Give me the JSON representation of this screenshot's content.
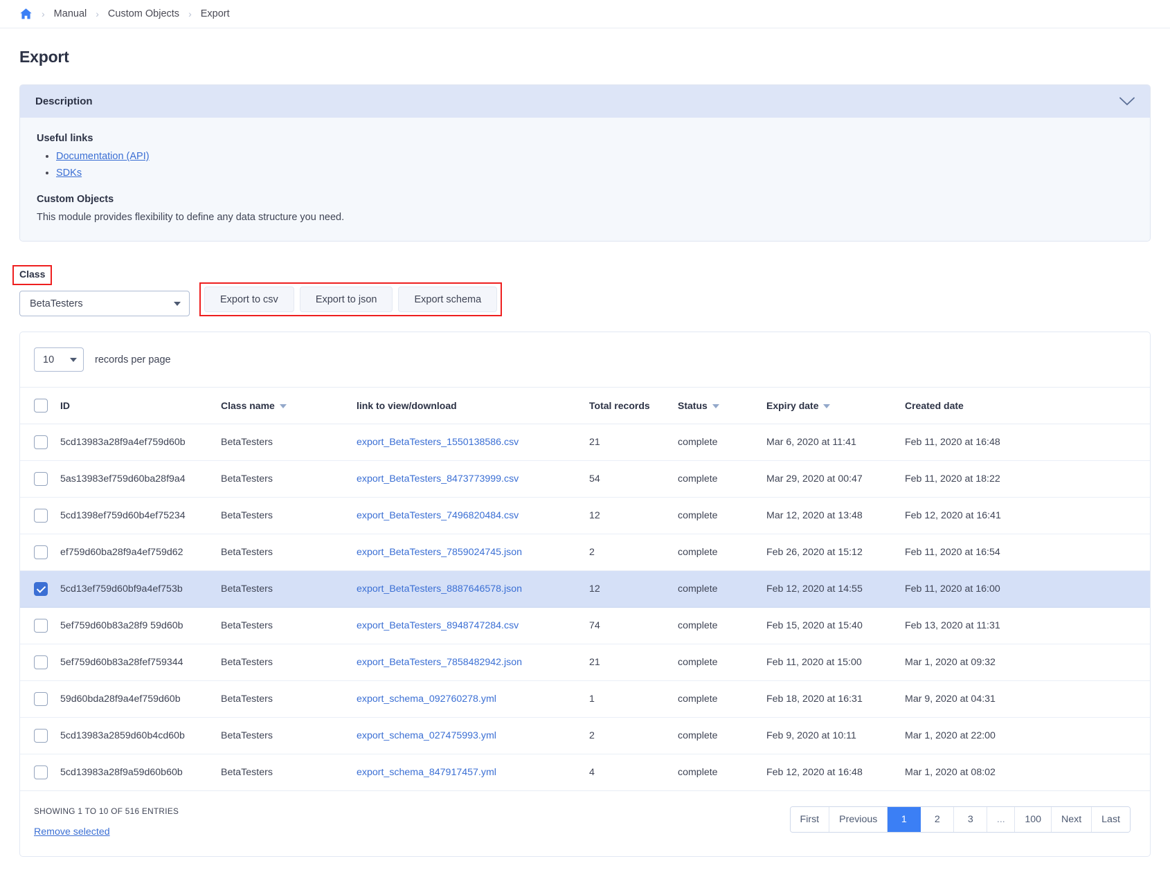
{
  "breadcrumb": {
    "home_icon": "home-icon",
    "items": [
      "Manual",
      "Custom Objects",
      "Export"
    ],
    "separator": "›"
  },
  "page": {
    "title": "Export"
  },
  "description": {
    "header": "Description",
    "collapse_icon": "chevron-down-icon",
    "useful_links_title": "Useful links",
    "links": [
      {
        "label": "Documentation (API)"
      },
      {
        "label": "SDKs"
      }
    ],
    "section_title": "Custom Objects",
    "section_text": "This module provides flexibility to define any data structure you need."
  },
  "class_selector": {
    "label": "Class",
    "value": "BetaTesters",
    "caret_icon": "chevron-down-icon"
  },
  "export_actions": {
    "buttons": [
      "Export to csv",
      "Export to json",
      "Export schema"
    ],
    "highlight_color": "#ee1f1f"
  },
  "table_controls": {
    "records_per_page_value": "10",
    "records_per_page_label": "records per page"
  },
  "table": {
    "select_all_checked": false,
    "columns": [
      {
        "key": "id",
        "label": "ID",
        "sortable": false
      },
      {
        "key": "class_name",
        "label": "Class name",
        "sortable": true
      },
      {
        "key": "link",
        "label": "link to view/download",
        "sortable": false
      },
      {
        "key": "total_records",
        "label": "Total records",
        "sortable": false
      },
      {
        "key": "status",
        "label": "Status",
        "sortable": true
      },
      {
        "key": "expiry_date",
        "label": "Expiry date",
        "sortable": true
      },
      {
        "key": "created_date",
        "label": "Created date",
        "sortable": false
      }
    ],
    "rows": [
      {
        "checked": false,
        "id": "5cd13983a28f9a4ef759d60b",
        "class_name": "BetaTesters",
        "link": "export_BetaTesters_1550138586.csv",
        "total_records": "21",
        "status": "complete",
        "expiry_date": "Mar 6, 2020 at 11:41",
        "created_date": "Feb 11, 2020 at 16:48"
      },
      {
        "checked": false,
        "id": "5as13983ef759d60ba28f9a4",
        "class_name": "BetaTesters",
        "link": "export_BetaTesters_8473773999.csv",
        "total_records": "54",
        "status": "complete",
        "expiry_date": "Mar 29, 2020 at 00:47",
        "created_date": "Feb 11, 2020 at 18:22"
      },
      {
        "checked": false,
        "id": "5cd1398ef759d60b4ef75234",
        "class_name": "BetaTesters",
        "link": "export_BetaTesters_7496820484.csv",
        "total_records": "12",
        "status": "complete",
        "expiry_date": "Mar 12, 2020 at 13:48",
        "created_date": "Feb 12, 2020 at 16:41"
      },
      {
        "checked": false,
        "id": "ef759d60ba28f9a4ef759d62",
        "class_name": "BetaTesters",
        "link": "export_BetaTesters_7859024745.json",
        "total_records": "2",
        "status": "complete",
        "expiry_date": "Feb 26, 2020 at 15:12",
        "created_date": "Feb 11, 2020 at 16:54"
      },
      {
        "checked": true,
        "id": "5cd13ef759d60bf9a4ef753b",
        "class_name": "BetaTesters",
        "link": "export_BetaTesters_8887646578.json",
        "total_records": "12",
        "status": "complete",
        "expiry_date": "Feb 12, 2020 at 14:55",
        "created_date": "Feb 11, 2020 at 16:00"
      },
      {
        "checked": false,
        "id": "5ef759d60b83a28f9 59d60b",
        "class_name": "BetaTesters",
        "link": "export_BetaTesters_8948747284.csv",
        "total_records": "74",
        "status": "complete",
        "expiry_date": "Feb 15, 2020 at 15:40",
        "created_date": "Feb 13, 2020 at 11:31"
      },
      {
        "checked": false,
        "id": "5ef759d60b83a28fef759344",
        "class_name": "BetaTesters",
        "link": "export_BetaTesters_7858482942.json",
        "total_records": "21",
        "status": "complete",
        "expiry_date": "Feb 11, 2020 at 15:00",
        "created_date": "Mar 1, 2020 at 09:32"
      },
      {
        "checked": false,
        "id": "59d60bda28f9a4ef759d60b",
        "class_name": "BetaTesters",
        "link": "export_schema_092760278.yml",
        "total_records": "1",
        "status": "complete",
        "expiry_date": "Feb 18, 2020 at 16:31",
        "created_date": "Mar 9, 2020 at 04:31"
      },
      {
        "checked": false,
        "id": "5cd13983a2859d60b4cd60b",
        "class_name": "BetaTesters",
        "link": "export_schema_027475993.yml",
        "total_records": "2",
        "status": "complete",
        "expiry_date": "Feb 9, 2020 at 10:11",
        "created_date": "Mar 1, 2020 at 22:00"
      },
      {
        "checked": false,
        "id": "5cd13983a28f9a59d60b60b",
        "class_name": "BetaTesters",
        "link": "export_schema_847917457.yml",
        "total_records": "4",
        "status": "complete",
        "expiry_date": "Feb 12, 2020 at 16:48",
        "created_date": "Mar 1, 2020 at 08:02"
      }
    ]
  },
  "footer": {
    "showing_text": "SHOWING 1 TO 10 OF 516 ENTRIES",
    "remove_selected": "Remove selected",
    "pagination": {
      "active": "1",
      "buttons": [
        "First",
        "Previous",
        "1",
        "2",
        "3",
        "...",
        "100",
        "Next",
        "Last"
      ]
    }
  },
  "colors": {
    "accent_blue": "#3b7ff5",
    "link_blue": "#3b6fd4",
    "selected_row": "#d5e0f7",
    "highlight_red": "#ee1f1f",
    "panel_header": "#dde5f7"
  }
}
